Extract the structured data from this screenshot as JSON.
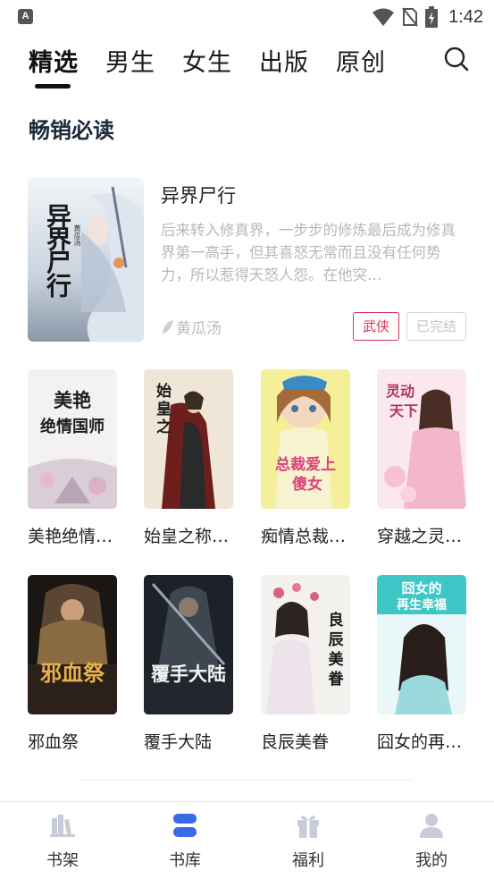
{
  "status_bar": {
    "app_icon_letter": "A",
    "time": "1:42"
  },
  "tabs": [
    {
      "label": "精选",
      "active": true
    },
    {
      "label": "男生",
      "active": false
    },
    {
      "label": "女生",
      "active": false
    },
    {
      "label": "出版",
      "active": false
    },
    {
      "label": "原创",
      "active": false
    }
  ],
  "section": {
    "title": "畅销必读"
  },
  "featured": {
    "title": "异界尸行",
    "description": "后来转入修真界，一步步的修炼最后成为修真界第一高手，但其喜怒无常而且没有任何势力，所以惹得天怒人怨。在他突…",
    "author": "黄瓜汤",
    "genre_tag": "武侠",
    "status_tag": "已完结",
    "cover_text": "异界尸行",
    "cover_author": "黄瓜汤"
  },
  "books": [
    {
      "title": "美艳绝情…",
      "cover_text": "美艳绝情国师"
    },
    {
      "title": "始皇之称…",
      "cover_text": "始皇之称大世"
    },
    {
      "title": "痴情总裁…",
      "cover_text": "总裁爱上傻女"
    },
    {
      "title": "穿越之灵…",
      "cover_text": "灵动天下"
    },
    {
      "title": "邪血祭",
      "cover_text": "邪血祭"
    },
    {
      "title": "覆手大陆",
      "cover_text": "覆手大陆"
    },
    {
      "title": "良辰美眷",
      "cover_text": "良辰美眷"
    },
    {
      "title": "囧女的再…",
      "cover_text": "囧女的再生幸福"
    }
  ],
  "bottom_nav": [
    {
      "label": "书架",
      "icon": "bookshelf-icon",
      "active": false
    },
    {
      "label": "书库",
      "icon": "library-icon",
      "active": true
    },
    {
      "label": "福利",
      "icon": "gift-icon",
      "active": false
    },
    {
      "label": "我的",
      "icon": "profile-icon",
      "active": false
    }
  ],
  "colors": {
    "accent_blue": "#3b6ae8",
    "genre_tag_red": "#d7335a",
    "muted_text": "#b8b8b8"
  }
}
